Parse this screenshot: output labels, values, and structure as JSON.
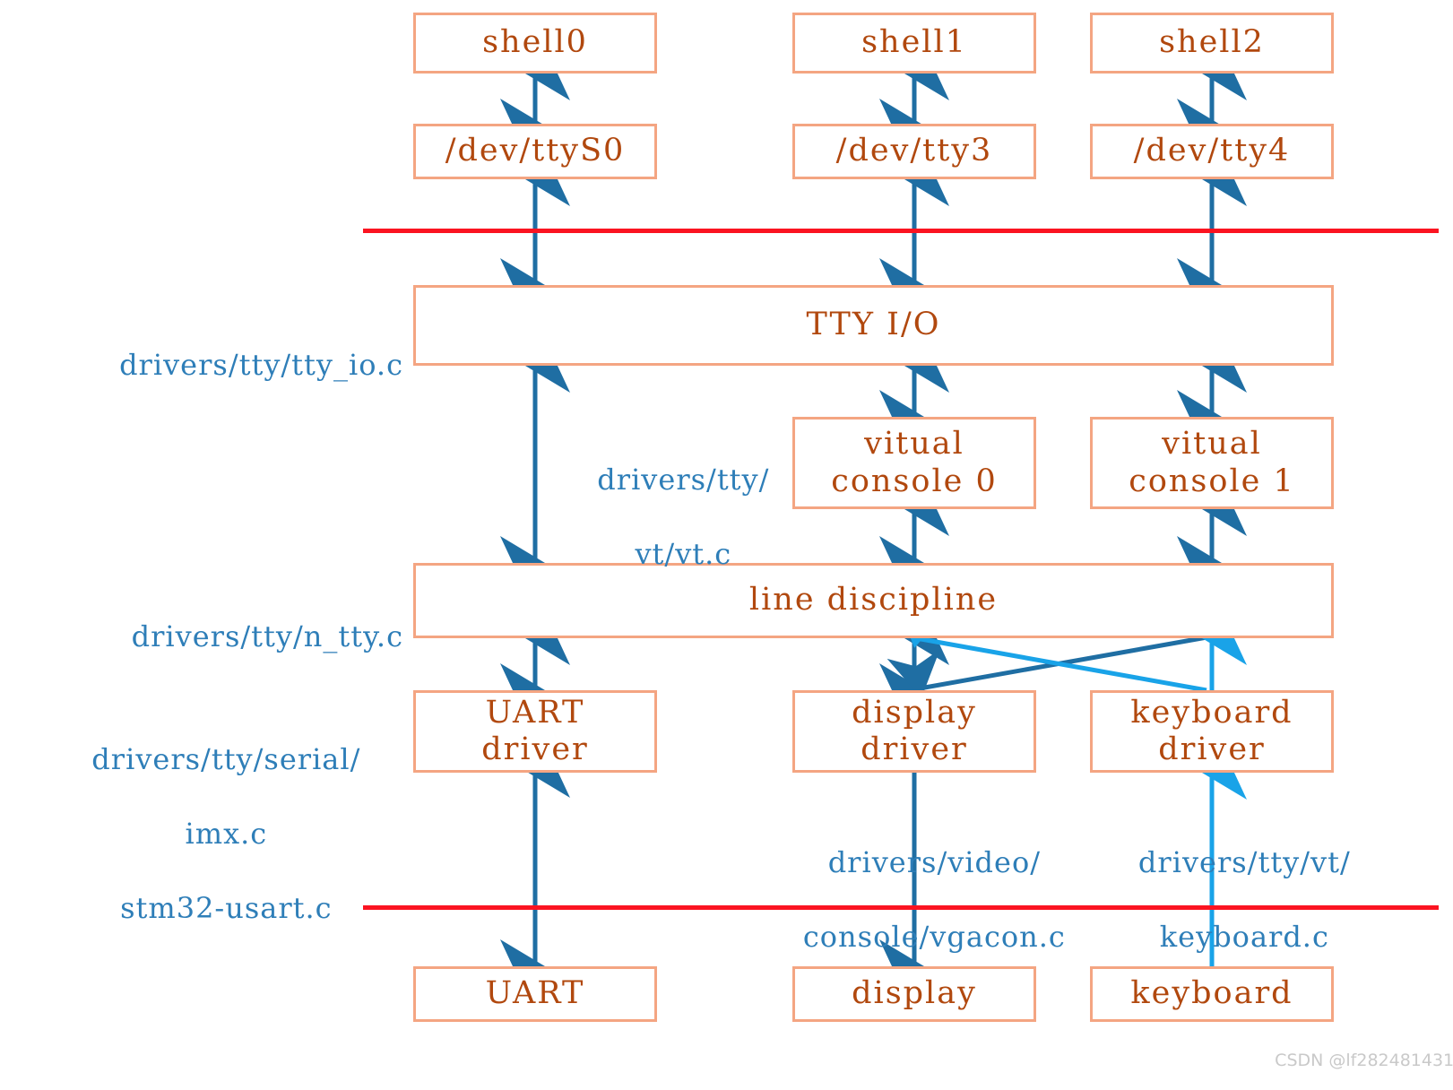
{
  "diagram": {
    "title": "Linux TTY subsystem layering",
    "colors": {
      "box_border": "#F4A582",
      "box_text": "#B1480E",
      "label_text": "#2E7EB8",
      "arrow_dark": "#1F6EA3",
      "arrow_light": "#19A3E8",
      "separator": "#FB1421",
      "background": "#FFFFFF"
    }
  },
  "boxes": {
    "shell0": "shell0",
    "shell1": "shell1",
    "shell2": "shell2",
    "tty_s0": "/dev/ttyS0",
    "tty3": "/dev/tty3",
    "tty4": "/dev/tty4",
    "tty_io": "TTY I/O",
    "vconsole0_l1": "vitual",
    "vconsole0_l2": "console 0",
    "vconsole1_l1": "vitual",
    "vconsole1_l2": "console 1",
    "line_discipline": "line discipline",
    "uart_driver_l1": "UART",
    "uart_driver_l2": "driver",
    "display_driver_l1": "display",
    "display_driver_l2": "driver",
    "keyboard_driver_l1": "keyboard",
    "keyboard_driver_l2": "driver",
    "uart": "UART",
    "display": "display",
    "keyboard": "keyboard"
  },
  "path_labels": {
    "tty_io": "drivers/tty/tty_io.c",
    "vt_l1": "drivers/tty/",
    "vt_l2": "vt/vt.c",
    "n_tty": "drivers/tty/n_tty.c",
    "serial_l1": "drivers/tty/serial/",
    "serial_l2": "imx.c",
    "serial_l3": "stm32-usart.c",
    "vgacon_l1": "drivers/video/",
    "vgacon_l2": "console/vgacon.c",
    "kbd_l1": "drivers/tty/vt/",
    "kbd_l2": "keyboard.c"
  },
  "watermark": "CSDN @lf282481431"
}
